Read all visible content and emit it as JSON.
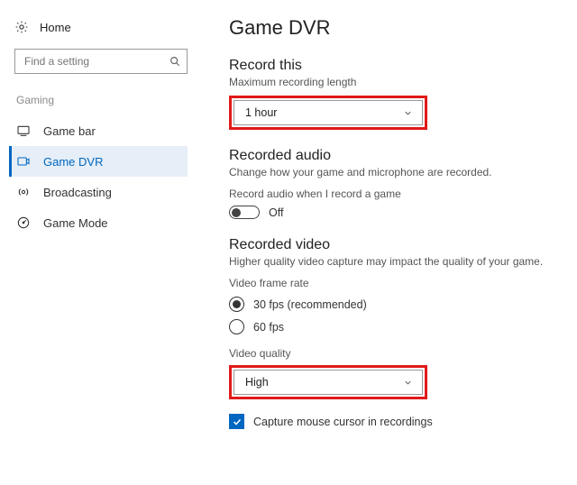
{
  "sidebar": {
    "home_label": "Home",
    "search_placeholder": "Find a setting",
    "group_label": "Gaming",
    "items": [
      {
        "label": "Game bar"
      },
      {
        "label": "Game DVR"
      },
      {
        "label": "Broadcasting"
      },
      {
        "label": "Game Mode"
      }
    ]
  },
  "page": {
    "title": "Game DVR"
  },
  "record_this": {
    "title": "Record this",
    "subtitle": "Maximum recording length",
    "value": "1 hour"
  },
  "recorded_audio": {
    "title": "Recorded audio",
    "subtitle": "Change how your game and microphone are recorded.",
    "toggle_label": "Record audio when I record a game",
    "toggle_state": "Off"
  },
  "recorded_video": {
    "title": "Recorded video",
    "subtitle": "Higher quality video capture may impact the quality of your game.",
    "frame_rate_label": "Video frame rate",
    "frame_rate_options": {
      "opt30": "30 fps (recommended)",
      "opt60": "60 fps"
    },
    "quality_label": "Video quality",
    "quality_value": "High"
  },
  "capture_cursor": {
    "label": "Capture mouse cursor in recordings"
  }
}
